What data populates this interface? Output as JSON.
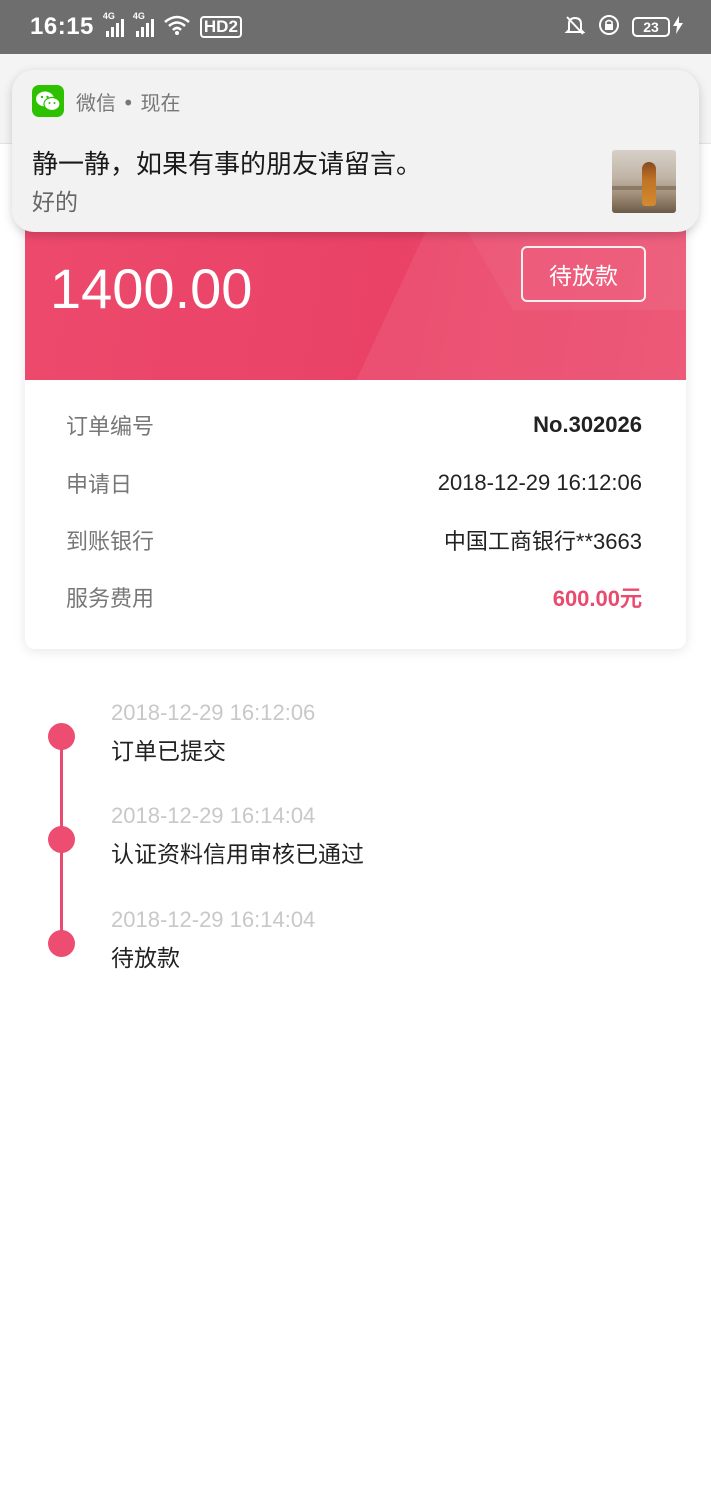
{
  "status_bar": {
    "time": "16:15",
    "signal_1_label": "4G",
    "signal_2_label": "4G",
    "hd_label": "HD2",
    "battery": "23"
  },
  "notification": {
    "app_line": "微信 • 现在",
    "title": "静一静，如果有事的朋友请留言。",
    "body": "好的"
  },
  "order": {
    "amount": "1400.00",
    "status_button": "待放款",
    "details": [
      {
        "label": "订单编号",
        "value": "No.302026"
      },
      {
        "label": "申请日",
        "value": "2018-12-29 16:12:06"
      },
      {
        "label": "到账银行",
        "value": "中国工商银行**3663"
      },
      {
        "label": "服务费用",
        "value": "600.00元"
      }
    ]
  },
  "timeline": [
    {
      "time": "2018-12-29 16:12:06",
      "text": "订单已提交"
    },
    {
      "time": "2018-12-29 16:14:04",
      "text": "认证资料信用审核已通过"
    },
    {
      "time": "2018-12-29 16:14:04",
      "text": "待放款"
    }
  ],
  "colors": {
    "accent": "#E94A6E",
    "wechat_green": "#2DC100",
    "status_bar": "#6E6E6E"
  },
  "icons": [
    "signal-icon",
    "wifi-icon",
    "hd-icon",
    "bell-off-icon",
    "alarm-lock-icon",
    "battery-icon",
    "charging-bolt-icon",
    "wechat-icon"
  ]
}
